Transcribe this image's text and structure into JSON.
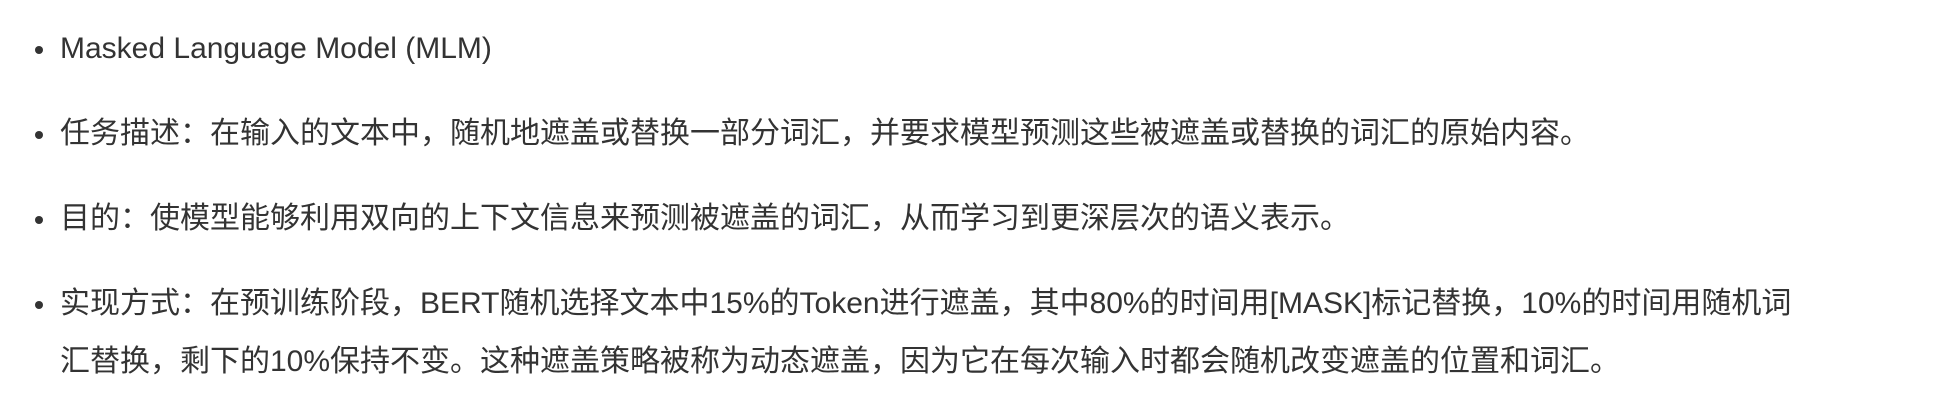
{
  "bullets": [
    {
      "text": "Masked Language Model (MLM)"
    },
    {
      "text": "任务描述：在输入的文本中，随机地遮盖或替换一部分词汇，并要求模型预测这些被遮盖或替换的词汇的原始内容。"
    },
    {
      "text": "目的：使模型能够利用双向的上下文信息来预测被遮盖的词汇，从而学习到更深层次的语义表示。"
    },
    {
      "line1": "实现方式：在预训练阶段，BERT随机选择文本中15%的Token进行遮盖，其中80%的时间用[MASK]标记替换，10%的时间用随机词",
      "line2": "汇替换，剩下的10%保持不变。这种遮盖策略被称为动态遮盖，因为它在每次输入时都会随机改变遮盖的位置和词汇。"
    }
  ]
}
